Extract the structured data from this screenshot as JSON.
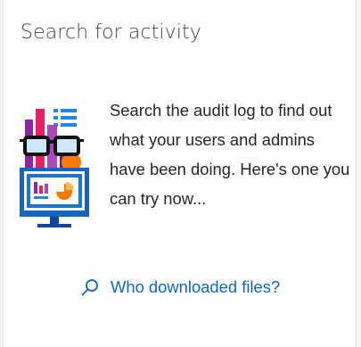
{
  "card": {
    "title": "Search for activity",
    "description": "Search the audit log to find out what your users and admins have been doing. Here's one you can try now...",
    "suggestion": {
      "icon": "search-icon",
      "label": "Who downloaded files?"
    },
    "illustration": {
      "icon": "audit-log-illustration"
    }
  },
  "colors": {
    "link": "#0a66c2",
    "title": "#444444",
    "text": "#262626"
  }
}
